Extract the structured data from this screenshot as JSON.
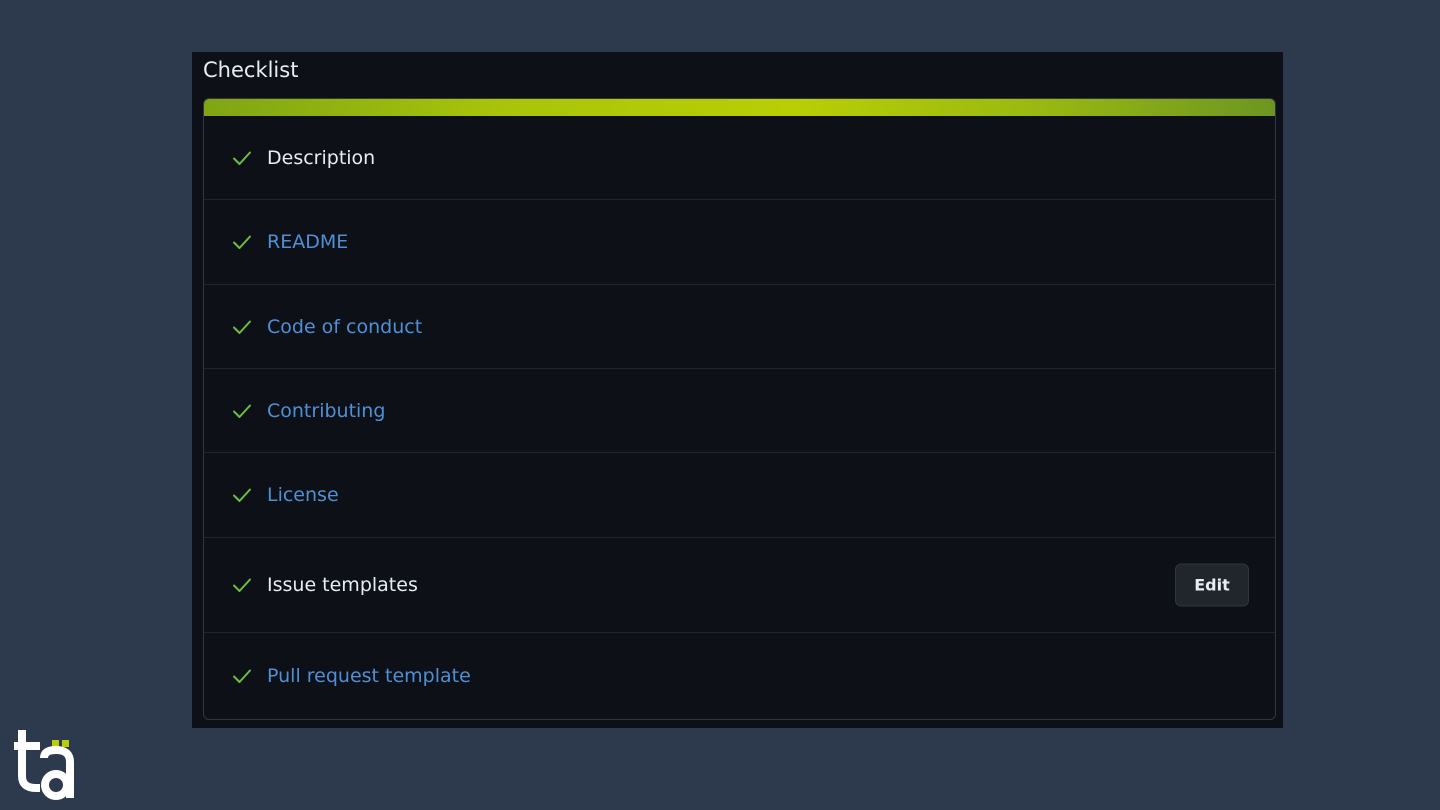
{
  "checklist": {
    "title": "Checklist",
    "progress_percent": 100,
    "items": [
      {
        "label": "Description",
        "is_link": false,
        "has_edit": false
      },
      {
        "label": "README",
        "is_link": true,
        "has_edit": false
      },
      {
        "label": "Code of conduct",
        "is_link": true,
        "has_edit": false
      },
      {
        "label": "Contributing",
        "is_link": true,
        "has_edit": false
      },
      {
        "label": "License",
        "is_link": true,
        "has_edit": false
      },
      {
        "label": "Issue templates",
        "is_link": false,
        "has_edit": true
      },
      {
        "label": "Pull request template",
        "is_link": true,
        "has_edit": false
      }
    ],
    "edit_label": "Edit"
  },
  "icons": {
    "item_status": "check-icon",
    "brand": "ta-logo"
  },
  "colors": {
    "page_background": "#2d3a4e",
    "panel_background": "#0d1117",
    "check_color": "#6dbd3f",
    "link_color": "#4f8fd6",
    "progress_start": "#7fa514",
    "progress_end": "#6c9622",
    "text_color": "#e6edf3"
  }
}
